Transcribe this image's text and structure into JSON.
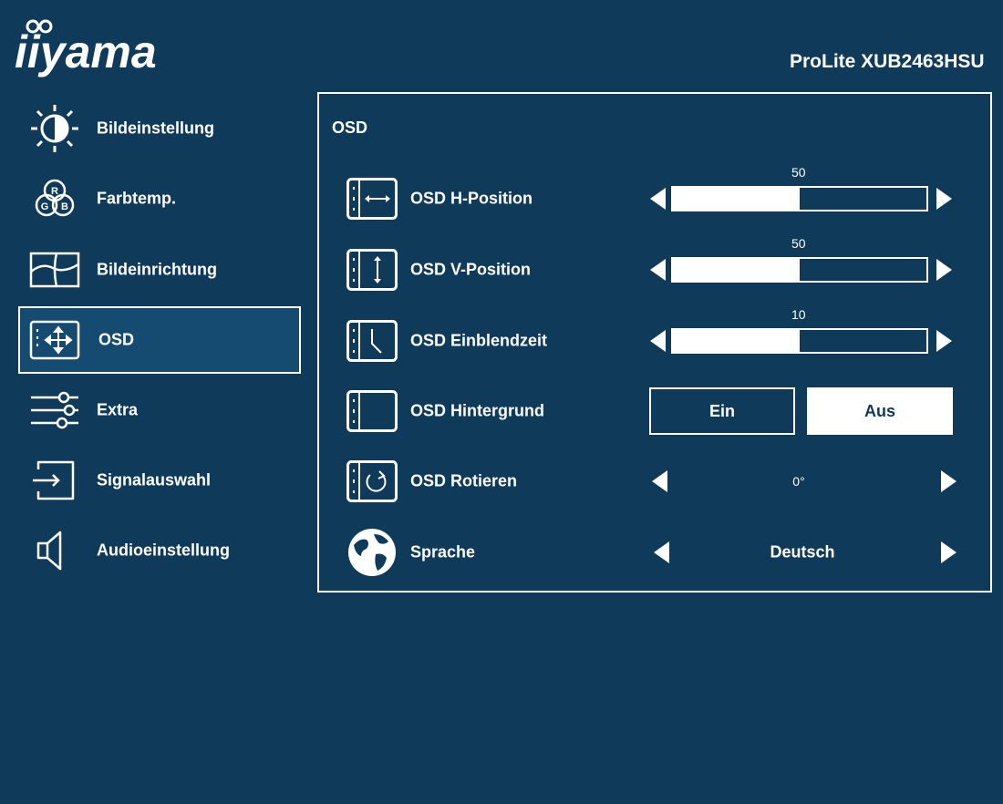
{
  "brand": {
    "logo_text": "iiyama",
    "model": "ProLite XUB2463HSU"
  },
  "sidebar": {
    "items": [
      {
        "label": "Bildeinstellung",
        "icon": "brightness-icon"
      },
      {
        "label": "Farbtemp.",
        "icon": "rgb-color-icon",
        "rgb": [
          "R",
          "G",
          "B"
        ]
      },
      {
        "label": "Bildeinrichtung",
        "icon": "image-setup-icon"
      },
      {
        "label": "OSD",
        "icon": "osd-move-icon",
        "active": true
      },
      {
        "label": "Extra",
        "icon": "sliders-icon"
      },
      {
        "label": "Signalauswahl",
        "icon": "input-source-icon"
      },
      {
        "label": "Audioeinstellung",
        "icon": "speaker-icon"
      }
    ]
  },
  "panel": {
    "title": "OSD",
    "rows": [
      {
        "label": "OSD H-Position",
        "type": "slider",
        "value": "50",
        "fraction": 0.5,
        "icon": "h-position-icon"
      },
      {
        "label": "OSD V-Position",
        "type": "slider",
        "value": "50",
        "fraction": 0.5,
        "icon": "v-position-icon"
      },
      {
        "label": "OSD Einblendzeit",
        "type": "slider",
        "value": "10",
        "fraction": 0.5,
        "icon": "timeout-icon"
      },
      {
        "label": "OSD Hintergrund",
        "type": "toggle",
        "options": [
          "Ein",
          "Aus"
        ],
        "selected": "Aus",
        "icon": "background-icon"
      },
      {
        "label": "OSD Rotieren",
        "type": "selector",
        "value": "0°",
        "icon": "rotate-icon"
      },
      {
        "label": "Sprache",
        "type": "selector",
        "value": "Deutsch",
        "icon": "globe-icon"
      }
    ]
  },
  "colors": {
    "background": "#0f3a5a",
    "active": "#154a71",
    "foreground": "#ffffff"
  }
}
